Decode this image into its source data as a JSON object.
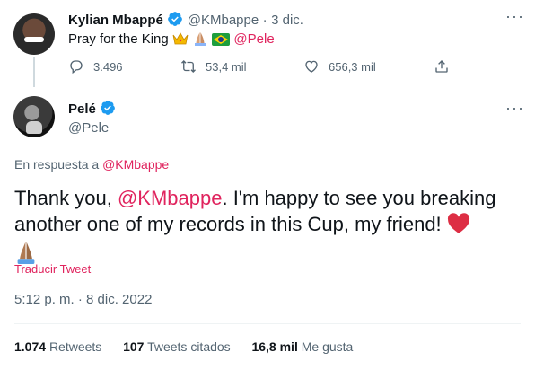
{
  "reply_tweet": {
    "author_name": "Kylian Mbappé",
    "handle": "@KMbappe",
    "separator": "·",
    "date": "3 dic.",
    "text": "Pray for the King",
    "mention": "@Pele",
    "stats": {
      "replies": "3.496",
      "retweets": "53,4 mil",
      "likes": "656,3 mil"
    }
  },
  "main_tweet": {
    "author_name": "Pelé",
    "handle": "@Pele",
    "reply_prefix": "En respuesta a",
    "reply_to": "@KMbappe",
    "text_before": "Thank you, ",
    "mention": "@KMbappe",
    "text_after": ". I'm happy to see you breaking another one of my records in this Cup, my friend!",
    "translate": "Traducir Tweet",
    "timestamp": "5:12 p. m. · 8 dic. 2022",
    "engagement": {
      "retweets_count": "1.074",
      "retweets_label": "Retweets",
      "quotes_count": "107",
      "quotes_label": "Tweets citados",
      "likes_count": "16,8 mil",
      "likes_label": "Me gusta"
    }
  },
  "colors": {
    "mention": "#e0245e",
    "verified": "#1d9bf0",
    "heart": "#e0245e"
  }
}
